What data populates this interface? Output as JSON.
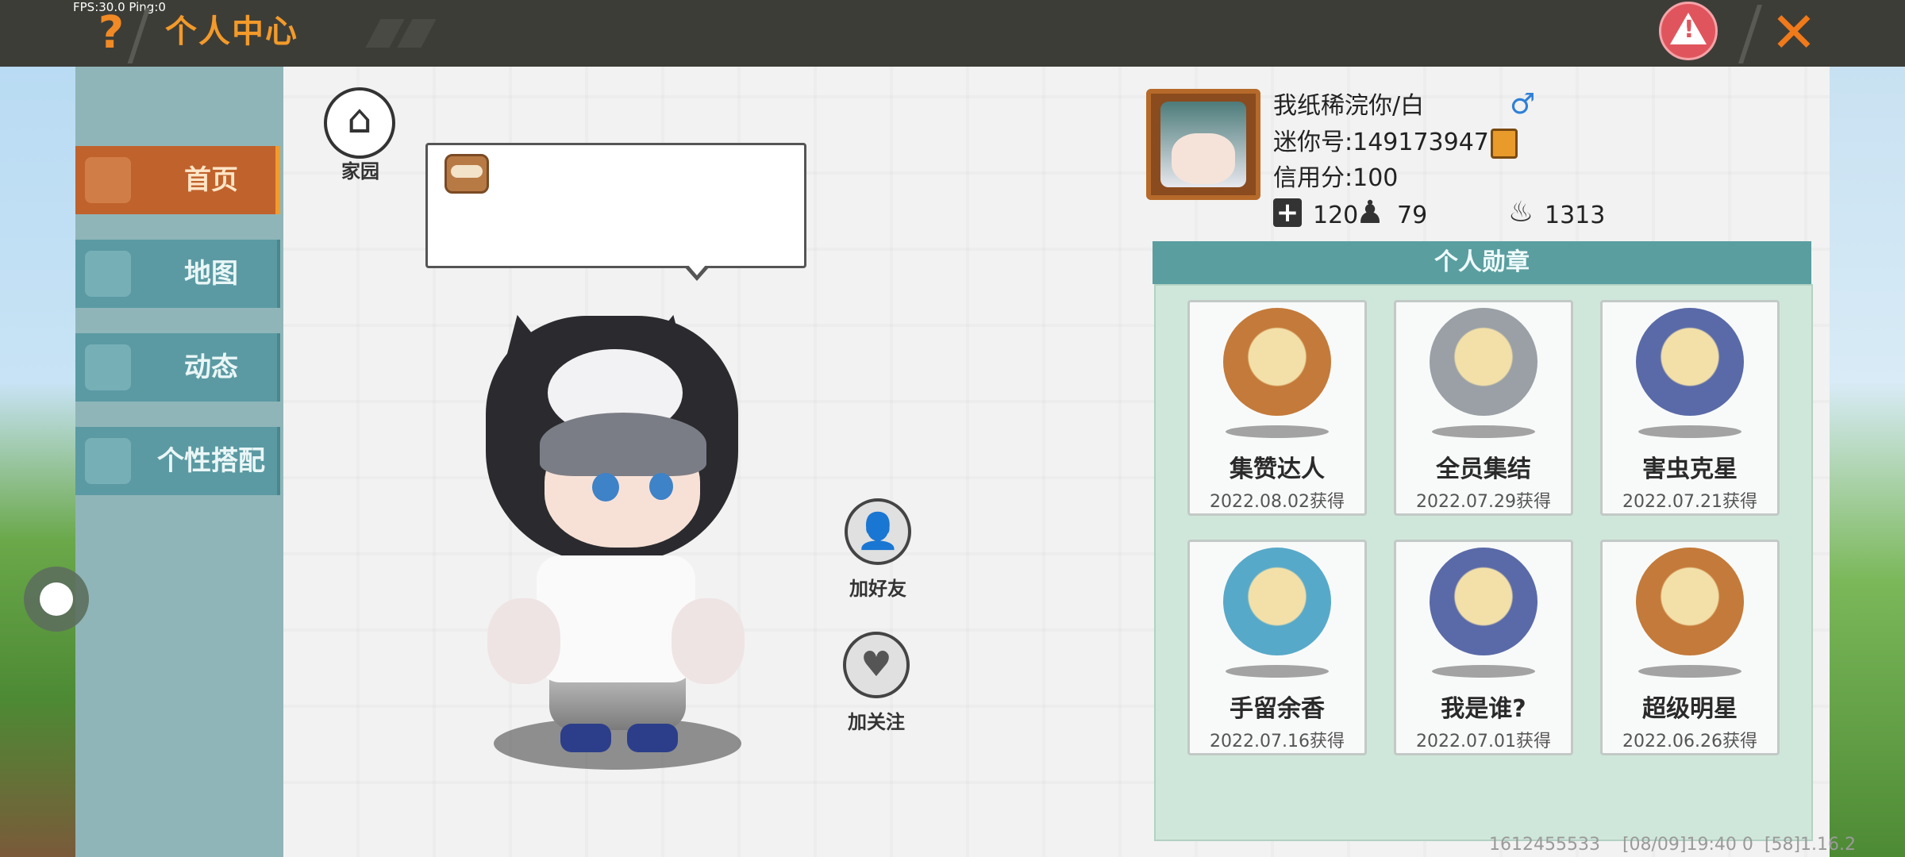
{
  "debug": {
    "fps_text": "FPS:30.0  Ping:0"
  },
  "header": {
    "title": "个人中心",
    "help_icon": "question-mark",
    "report_icon": "warning-triangle",
    "close_icon": "close-x",
    "accent_color": "#f39a2a"
  },
  "sidebar": {
    "items": [
      {
        "label": "首页",
        "icon": "shirt-icon",
        "active": true
      },
      {
        "label": "地图",
        "icon": "map-icon",
        "active": false
      },
      {
        "label": "动态",
        "icon": "bell-icon",
        "active": false
      },
      {
        "label": "个性搭配",
        "icon": "face-icon",
        "active": false
      }
    ]
  },
  "home": {
    "label": "家园"
  },
  "actions": {
    "add_friend_label": "加好友",
    "follow_label": "加关注"
  },
  "profile": {
    "nickname": "我纸稀浣你/白",
    "gender_symbol": "♂",
    "mini_id": "迷你号:1491739477",
    "credit": "信用分:100",
    "stats": {
      "add": "120",
      "fans": "79",
      "hot": "1313"
    }
  },
  "medals": {
    "title": "个人勋章",
    "items": [
      {
        "name": "集赞达人",
        "date": "2022.08.02获得",
        "color": "#c47a3a"
      },
      {
        "name": "全员集结",
        "date": "2022.07.29获得",
        "color": "#9aa0a6"
      },
      {
        "name": "害虫克星",
        "date": "2022.07.21获得",
        "color": "#5a6aa8"
      },
      {
        "name": "手留余香",
        "date": "2022.07.16获得",
        "color": "#57a9c9"
      },
      {
        "name": "我是谁?",
        "date": "2022.07.01获得",
        "color": "#5a6aa8"
      },
      {
        "name": "超级明星",
        "date": "2022.06.26获得",
        "color": "#c47a3a"
      }
    ]
  },
  "footer": {
    "text": "1612455533    [08/09]19:40 0  [58]1.16.2"
  }
}
